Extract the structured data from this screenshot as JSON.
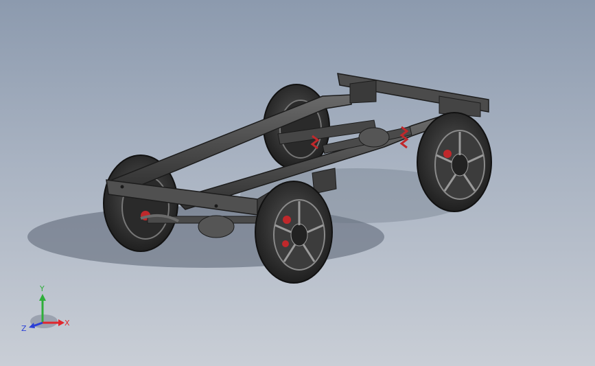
{
  "viewport": {
    "background_top": "#8c9aae",
    "background_bottom": "#c9ced6",
    "model_color": "#3b3b3b",
    "accent_red": "#c0282b"
  },
  "triad": {
    "x_label": "X",
    "y_label": "Y",
    "z_label": "Z",
    "x_color": "#e0262c",
    "y_color": "#2fae3a",
    "z_color": "#2a3fd6"
  }
}
